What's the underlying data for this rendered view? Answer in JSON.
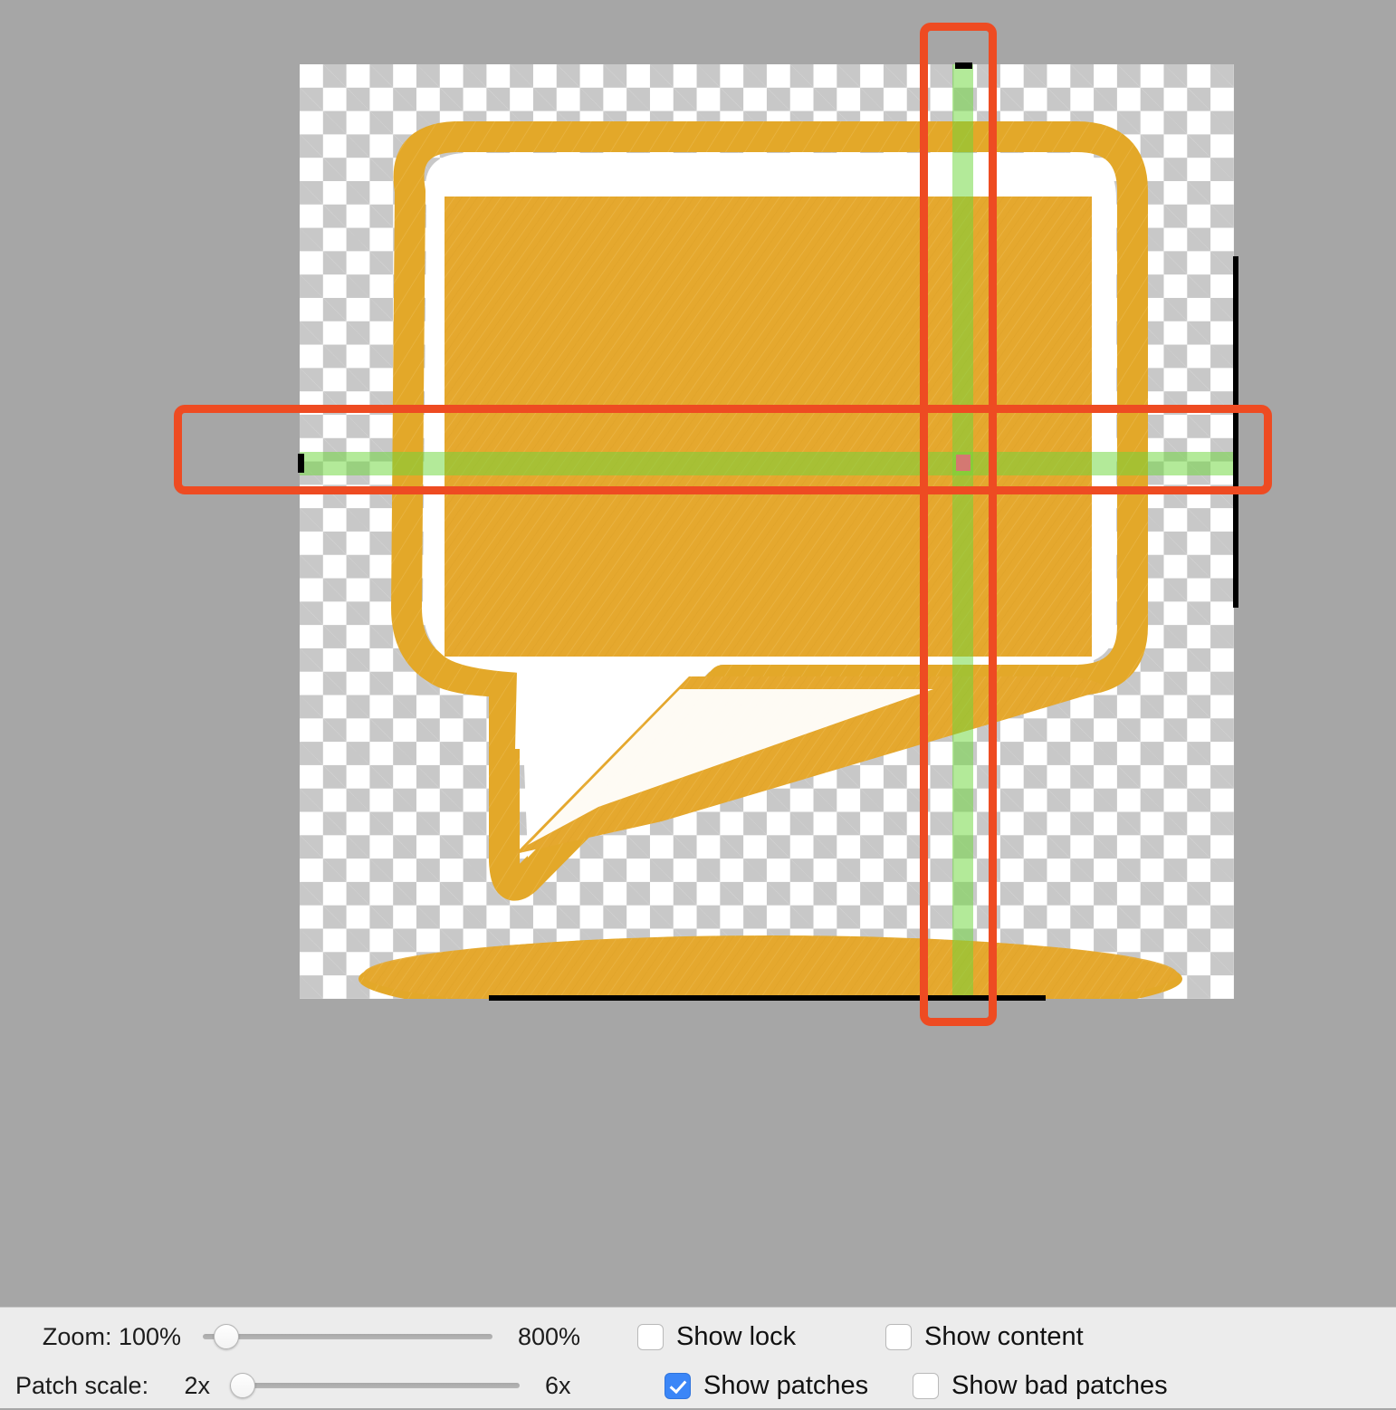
{
  "window": {
    "background_color": "#a6a6a6",
    "canvas_background": "transparent-checkerboard"
  },
  "canvas": {
    "artwork_name": "speech-bubble-sketch",
    "artwork_colors": {
      "stroke_gold": "#e3a829",
      "fill_gold": "#e5a82e",
      "inner_white": "#ffffff"
    },
    "overlays": {
      "patch_highlight_color": "#6ed73c",
      "patch_center_color": "#e2687d",
      "selection_rect_color": "#ee4b22",
      "ruler_color": "#000000"
    }
  },
  "controls": {
    "zoom": {
      "label": "Zoom: 100%",
      "value_percent": 100,
      "max_label": "800%",
      "max_percent": 800,
      "thumb_position_percent": 4
    },
    "patch_scale": {
      "label": "Patch scale:",
      "min_label": "2x",
      "max_label": "6x",
      "value": "2x",
      "thumb_position_percent": 0
    },
    "checkboxes": [
      {
        "name": "show-lock",
        "label": "Show lock",
        "checked": false
      },
      {
        "name": "show-content",
        "label": "Show content",
        "checked": false
      },
      {
        "name": "show-patches",
        "label": "Show patches",
        "checked": true
      },
      {
        "name": "show-bad-patches",
        "label": "Show bad patches",
        "checked": false
      }
    ]
  }
}
